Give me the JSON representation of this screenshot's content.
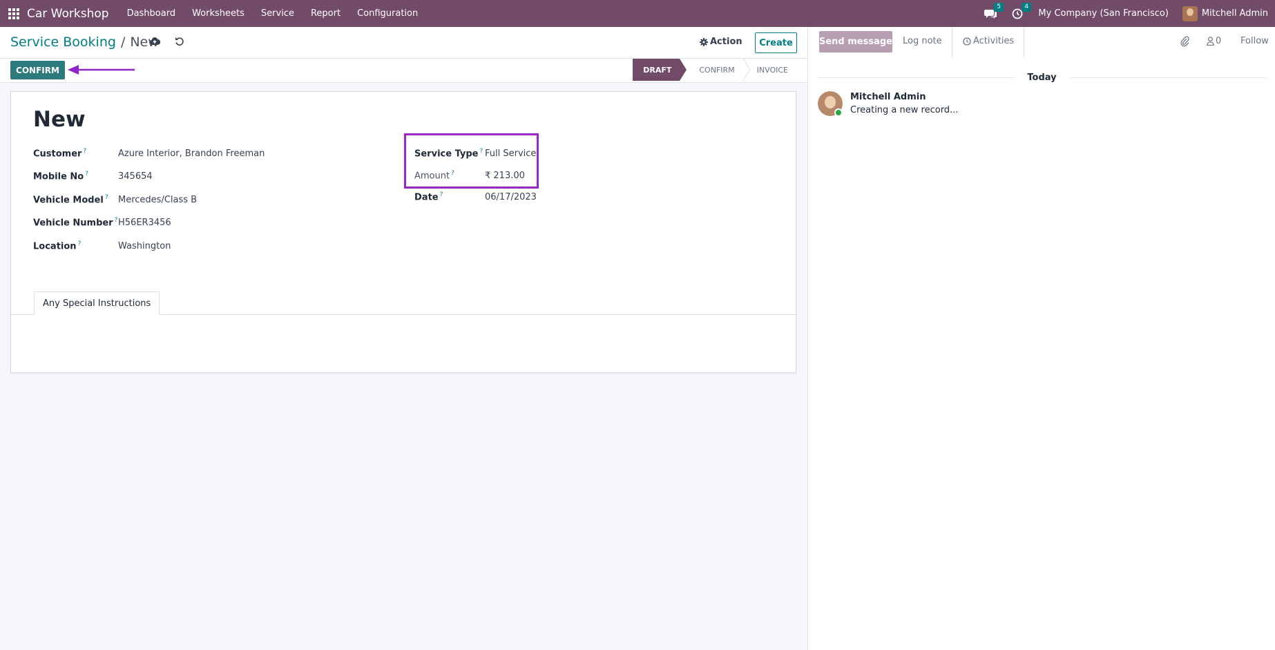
{
  "navbar": {
    "app_name": "Car Workshop",
    "menu": [
      "Dashboard",
      "Worksheets",
      "Service",
      "Report",
      "Configuration"
    ],
    "messages_count": "5",
    "activities_count": "4",
    "company": "My Company (San Francisco)",
    "user": "Mitchell Admin"
  },
  "control": {
    "breadcrumb_parent": "Service Booking",
    "breadcrumb_sep": "/",
    "breadcrumb_current": "New",
    "action_label": "Action",
    "create_label": "Create"
  },
  "statusbar": {
    "confirm_label": "CONFIRM",
    "stages": [
      "DRAFT",
      "CONFIRM",
      "INVOICE"
    ],
    "active_stage": "DRAFT"
  },
  "form": {
    "title": "New",
    "left_fields": [
      {
        "label": "Customer",
        "value": "Azure Interior, Brandon Freeman"
      },
      {
        "label": "Mobile No",
        "value": "345654"
      },
      {
        "label": "Vehicle Model",
        "value": "Mercedes/Class B"
      },
      {
        "label": "Vehicle Number",
        "value": "H56ER3456"
      },
      {
        "label": "Location",
        "value": "Washington"
      }
    ],
    "right_fields": [
      {
        "label": "Service Type",
        "value": "Full Service"
      },
      {
        "label": "Amount",
        "value": "₹ 213.00"
      },
      {
        "label": "Date",
        "value": "06/17/2023"
      }
    ],
    "help_mark": "?",
    "tab_label": "Any Special Instructions"
  },
  "chatter": {
    "send_message": "Send message",
    "log_note": "Log note",
    "activities": "Activities",
    "followers_count": "0",
    "follow": "Follow",
    "date_separator": "Today",
    "messages": [
      {
        "author": "Mitchell Admin",
        "body": "Creating a new record..."
      }
    ]
  },
  "colors": {
    "brand": "#714b67",
    "accent": "#017e84",
    "confirm_button": "#2c7a7b",
    "highlight": "#9b26c6"
  }
}
